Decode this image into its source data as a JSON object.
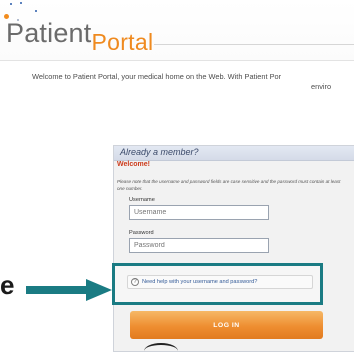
{
  "brand": {
    "logo_part1": "Patient",
    "logo_part2": "Portal",
    "colors": {
      "logo_gray": "#6b6b6b",
      "logo_orange": "#ef8a1f",
      "dot_orange": "#f28c1e",
      "dot_blue": "#2a5caa"
    }
  },
  "intro": {
    "line1": "Welcome to Patient Portal, your medical home on the Web. With Patient Por",
    "line2": "enviro"
  },
  "login_panel": {
    "title": "Already a member?",
    "welcome": "Welcome!",
    "note": "Please note that the username and password fields are case sensitive and the password must contain at least one number.",
    "username_label": "Username",
    "username_placeholder": "Username",
    "password_label": "Password",
    "password_placeholder": "Password",
    "help_link": "Need help with your username and password?",
    "help_icon": "question-circle-icon",
    "login_button": "LOG IN"
  },
  "annotation": {
    "left_glyph": "e",
    "arrow_icon": "arrow-right-icon",
    "highlight_color": "#1a7b83"
  }
}
